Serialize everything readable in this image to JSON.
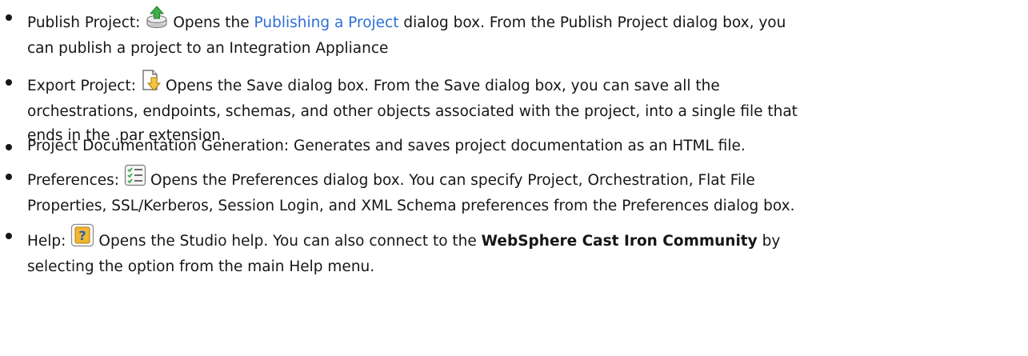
{
  "items": [
    {
      "label": "Publish Project:",
      "icon": "publish-project-icon",
      "text_before_link": "Opens the ",
      "link": "Publishing a Project",
      "text_after_link": " dialog box. From the Publish Project dialog box, you",
      "line2": "can publish a project to an Integration Appliance"
    },
    {
      "label": "Export Project:",
      "icon": "export-project-icon",
      "line1": "Opens the Save dialog box. From the Save dialog box, you can save all the",
      "line2": "orchestrations, endpoints, schemas, and other objects associated with the project, into a single file that",
      "line3": "ends in the .par extension."
    },
    {
      "text": "Project Documentation Generation: Generates and saves project documentation as an HTML file."
    },
    {
      "label": "Preferences:",
      "icon": "preferences-icon",
      "line1": "Opens the Preferences dialog box. You can specify Project, Orchestration, Flat File",
      "line2": "Properties, SSL/Kerberos, Session Login, and XML Schema preferences from the Preferences dialog box."
    },
    {
      "label": "Help:",
      "icon": "help-icon",
      "line1_before": "Opens the Studio help. You can also connect to the ",
      "line1_bold": "WebSphere Cast Iron Community",
      "line1_after": " by",
      "line2": "selecting the option from the main Help menu."
    }
  ],
  "colors": {
    "text": "#161616",
    "link": "#2d6fd6"
  }
}
